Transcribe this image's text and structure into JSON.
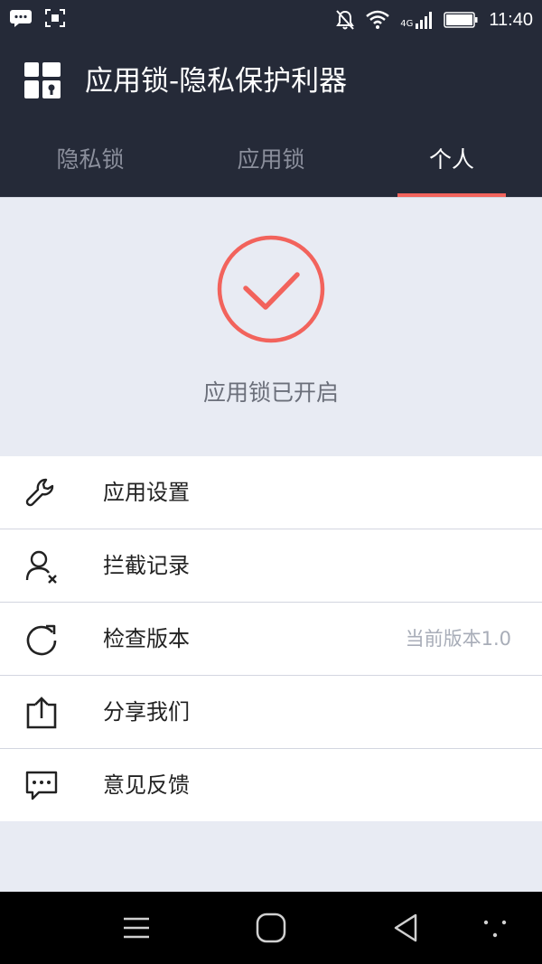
{
  "status_bar": {
    "network": "4G",
    "time": "11:40"
  },
  "header": {
    "title": "应用锁-隐私保护利器",
    "app_icon": "app-lock-grid-icon"
  },
  "tabs": [
    {
      "label": "隐私锁",
      "active": false
    },
    {
      "label": "应用锁",
      "active": false
    },
    {
      "label": "个人",
      "active": true
    }
  ],
  "hero": {
    "icon": "check-circle-icon",
    "status_text": "应用锁已开启"
  },
  "menu": {
    "items": [
      {
        "label": "应用设置",
        "icon": "wrench-icon",
        "value": ""
      },
      {
        "label": "拦截记录",
        "icon": "user-blocked-icon",
        "value": ""
      },
      {
        "label": "检查版本",
        "icon": "refresh-icon",
        "value": "当前版本1.0"
      },
      {
        "label": "分享我们",
        "icon": "share-icon",
        "value": ""
      },
      {
        "label": "意见反馈",
        "icon": "feedback-icon",
        "value": ""
      }
    ]
  },
  "colors": {
    "header_bg": "#252a38",
    "accent": "#f2635c",
    "page_bg": "#e8ebf3"
  }
}
